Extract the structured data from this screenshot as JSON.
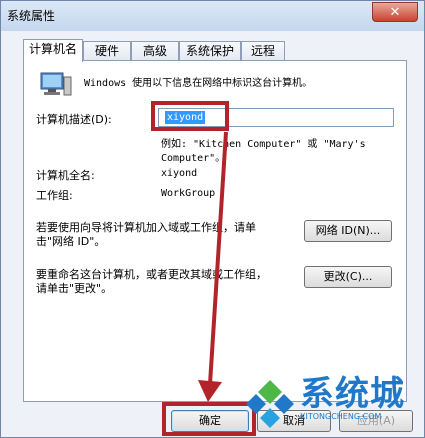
{
  "window": {
    "title": "系统属性",
    "close_glyph": "✕"
  },
  "tabs": [
    {
      "label": "计算机名",
      "active": true
    },
    {
      "label": "硬件",
      "active": false
    },
    {
      "label": "高级",
      "active": false
    },
    {
      "label": "系统保护",
      "active": false
    },
    {
      "label": "远程",
      "active": false
    }
  ],
  "info_text": "Windows 使用以下信息在网络中标识这台计算机。",
  "description": {
    "label": "计算机描述(D):",
    "value": "xiyond",
    "example_line1": "例如: \"Kitchen Computer\" 或 \"Mary's",
    "example_line2": "Computer\"。"
  },
  "full_name": {
    "label": "计算机全名:",
    "value": "xiyond"
  },
  "workgroup": {
    "label": "工作组:",
    "value": "WorkGroup"
  },
  "network_id": {
    "text_line1": "若要使用向导将计算机加入域或工作组，请单",
    "text_line2": "击\"网络 ID\"。",
    "button": "网络 ID(N)..."
  },
  "rename": {
    "text_line1": "要重命名这台计算机，或者更改其域或工作组，",
    "text_line2": "请单击\"更改\"。",
    "button": "更改(C)..."
  },
  "footer": {
    "ok": "确定",
    "cancel": "取消",
    "apply": "应用(A)"
  },
  "watermark": {
    "brand": "系统城",
    "domain": "XITONGCHENG.COM"
  },
  "colors": {
    "highlight": "#b3232a",
    "selection": "#3399ff",
    "brand": "#1f78c8"
  }
}
